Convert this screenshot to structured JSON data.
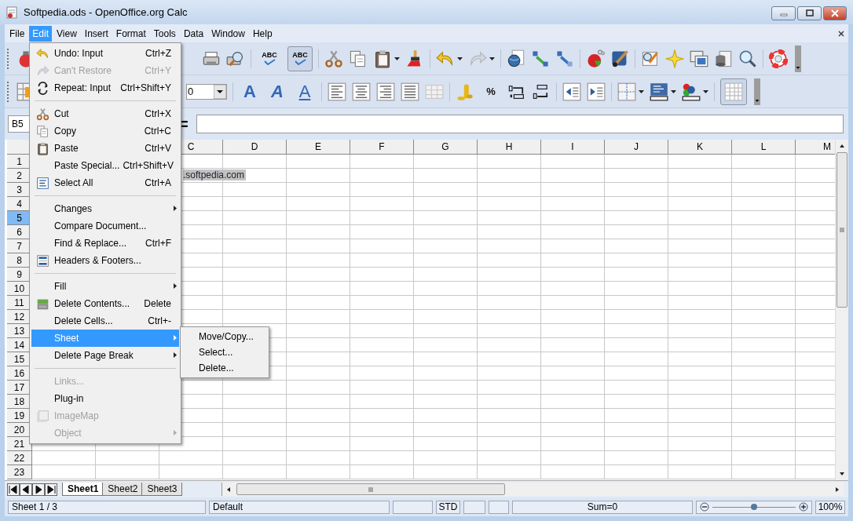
{
  "window": {
    "title": "Softpedia.ods - OpenOffice.org Calc"
  },
  "menubar": [
    {
      "label": "File",
      "selected": false
    },
    {
      "label": "Edit",
      "selected": true
    },
    {
      "label": "View",
      "selected": false
    },
    {
      "label": "Insert",
      "selected": false
    },
    {
      "label": "Format",
      "selected": false
    },
    {
      "label": "Tools",
      "selected": false
    },
    {
      "label": "Data",
      "selected": false
    },
    {
      "label": "Window",
      "selected": false
    },
    {
      "label": "Help",
      "selected": false
    }
  ],
  "standard_toolbar": {
    "buttons": [
      {
        "label": "ABC"
      },
      {
        "label": "ABC",
        "pressed": true
      }
    ]
  },
  "formatting_toolbar": {
    "font_size": "0",
    "buttons": [
      {
        "label": "A",
        "kind": "bold"
      },
      {
        "label": "A",
        "kind": "italic"
      },
      {
        "label": "A",
        "kind": "underline"
      },
      {
        "label": "%",
        "kind": "plain"
      }
    ],
    "grid_toggle_pressed": true
  },
  "formula_bar": {
    "cell_ref": "B5",
    "equals": "="
  },
  "sheet": {
    "columns": [
      "C",
      "D",
      "E",
      "F",
      "G",
      "H",
      "I",
      "J",
      "K",
      "L",
      "M"
    ],
    "rows": [
      {
        "label": "1",
        "selected": false
      },
      {
        "label": "2",
        "selected": false
      },
      {
        "label": "3",
        "selected": false
      },
      {
        "label": "4",
        "selected": false
      },
      {
        "label": "5",
        "selected": true
      },
      {
        "label": "6",
        "selected": false
      },
      {
        "label": "7",
        "selected": false
      },
      {
        "label": "8",
        "selected": false
      },
      {
        "label": "9",
        "selected": false
      },
      {
        "label": "10",
        "selected": false
      },
      {
        "label": "11",
        "selected": false
      },
      {
        "label": "12",
        "selected": false
      },
      {
        "label": "13",
        "selected": false
      },
      {
        "label": "14",
        "selected": false
      },
      {
        "label": "15",
        "selected": false
      },
      {
        "label": "16",
        "selected": false
      },
      {
        "label": "17",
        "selected": false
      },
      {
        "label": "18",
        "selected": false
      },
      {
        "label": "19",
        "selected": false
      },
      {
        "label": "20",
        "selected": false
      },
      {
        "label": "21",
        "selected": false
      },
      {
        "label": "22",
        "selected": false
      },
      {
        "label": "23",
        "selected": false
      }
    ],
    "cell_text": ".softpedia.com"
  },
  "edit_menu": [
    {
      "kind": "item",
      "label": "Undo: Input",
      "shortcut": "Ctrl+Z",
      "disabled": false,
      "submenu": false,
      "selected": false
    },
    {
      "kind": "item",
      "label": "Can't Restore",
      "shortcut": "Ctrl+Y",
      "disabled": true,
      "submenu": false,
      "selected": false
    },
    {
      "kind": "item",
      "label": "Repeat: Input",
      "shortcut": "Ctrl+Shift+Y",
      "disabled": false,
      "submenu": false,
      "selected": false
    },
    {
      "kind": "separator"
    },
    {
      "kind": "item",
      "label": "Cut",
      "shortcut": "Ctrl+X",
      "disabled": false,
      "submenu": false,
      "selected": false
    },
    {
      "kind": "item",
      "label": "Copy",
      "shortcut": "Ctrl+C",
      "disabled": false,
      "submenu": false,
      "selected": false
    },
    {
      "kind": "item",
      "label": "Paste",
      "shortcut": "Ctrl+V",
      "disabled": false,
      "submenu": false,
      "selected": false
    },
    {
      "kind": "item",
      "label": "Paste Special...",
      "shortcut": "Ctrl+Shift+V",
      "disabled": false,
      "submenu": false,
      "selected": false
    },
    {
      "kind": "item",
      "label": "Select All",
      "shortcut": "Ctrl+A",
      "disabled": false,
      "submenu": false,
      "selected": false
    },
    {
      "kind": "separator"
    },
    {
      "kind": "item",
      "label": "Changes",
      "disabled": false,
      "submenu": true,
      "selected": false
    },
    {
      "kind": "item",
      "label": "Compare Document...",
      "disabled": false,
      "submenu": false,
      "selected": false
    },
    {
      "kind": "item",
      "label": "Find & Replace...",
      "shortcut": "Ctrl+F",
      "disabled": false,
      "submenu": false,
      "selected": false
    },
    {
      "kind": "item",
      "label": "Headers & Footers...",
      "disabled": false,
      "submenu": false,
      "selected": false
    },
    {
      "kind": "separator"
    },
    {
      "kind": "item",
      "label": "Fill",
      "disabled": false,
      "submenu": true,
      "selected": false
    },
    {
      "kind": "item",
      "label": "Delete Contents...",
      "shortcut": "Delete",
      "disabled": false,
      "submenu": false,
      "selected": false
    },
    {
      "kind": "item",
      "label": "Delete Cells...",
      "shortcut": "Ctrl+-",
      "disabled": false,
      "submenu": false,
      "selected": false
    },
    {
      "kind": "item",
      "label": "Sheet",
      "disabled": false,
      "submenu": true,
      "selected": true
    },
    {
      "kind": "item",
      "label": "Delete Page Break",
      "disabled": false,
      "submenu": true,
      "selected": false
    },
    {
      "kind": "separator"
    },
    {
      "kind": "item",
      "label": "Links...",
      "disabled": true,
      "submenu": false,
      "selected": false
    },
    {
      "kind": "item",
      "label": "Plug-in",
      "disabled": false,
      "submenu": false,
      "selected": false
    },
    {
      "kind": "item",
      "label": "ImageMap",
      "disabled": true,
      "submenu": false,
      "selected": false
    },
    {
      "kind": "item",
      "label": "Object",
      "disabled": true,
      "submenu": true,
      "selected": false
    }
  ],
  "sheet_submenu": [
    {
      "label": "Move/Copy..."
    },
    {
      "label": "Select..."
    },
    {
      "label": "Delete..."
    }
  ],
  "sheet_tabs": [
    {
      "label": "Sheet1",
      "selected": true
    },
    {
      "label": "Sheet2",
      "selected": false
    },
    {
      "label": "Sheet3",
      "selected": false
    }
  ],
  "status_bar": {
    "sheet": "Sheet 1 / 3",
    "page_style": "Default",
    "mode": "STD",
    "sum": "Sum=0",
    "zoom": {
      "level": 0.5,
      "reading": "100%"
    }
  }
}
